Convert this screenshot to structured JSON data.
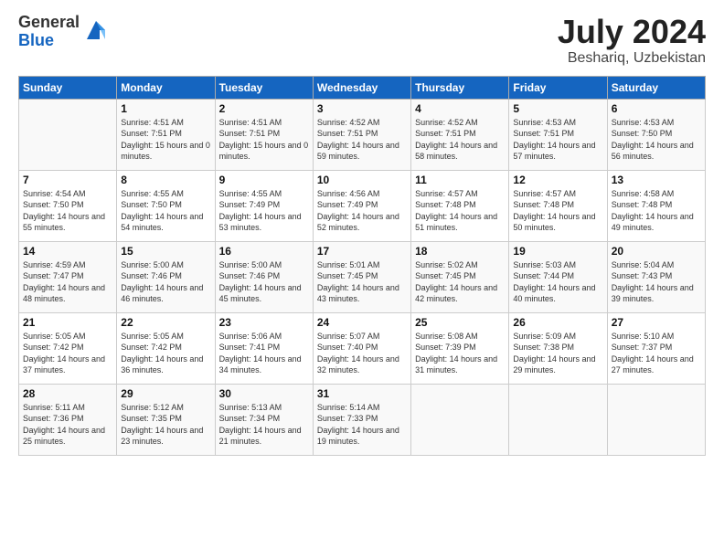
{
  "logo": {
    "general": "General",
    "blue": "Blue"
  },
  "title": {
    "month_year": "July 2024",
    "location": "Beshariq, Uzbekistan"
  },
  "days_of_week": [
    "Sunday",
    "Monday",
    "Tuesday",
    "Wednesday",
    "Thursday",
    "Friday",
    "Saturday"
  ],
  "weeks": [
    [
      {
        "day": "",
        "sunrise": "",
        "sunset": "",
        "daylight": ""
      },
      {
        "day": "1",
        "sunrise": "Sunrise: 4:51 AM",
        "sunset": "Sunset: 7:51 PM",
        "daylight": "Daylight: 15 hours and 0 minutes."
      },
      {
        "day": "2",
        "sunrise": "Sunrise: 4:51 AM",
        "sunset": "Sunset: 7:51 PM",
        "daylight": "Daylight: 15 hours and 0 minutes."
      },
      {
        "day": "3",
        "sunrise": "Sunrise: 4:52 AM",
        "sunset": "Sunset: 7:51 PM",
        "daylight": "Daylight: 14 hours and 59 minutes."
      },
      {
        "day": "4",
        "sunrise": "Sunrise: 4:52 AM",
        "sunset": "Sunset: 7:51 PM",
        "daylight": "Daylight: 14 hours and 58 minutes."
      },
      {
        "day": "5",
        "sunrise": "Sunrise: 4:53 AM",
        "sunset": "Sunset: 7:51 PM",
        "daylight": "Daylight: 14 hours and 57 minutes."
      },
      {
        "day": "6",
        "sunrise": "Sunrise: 4:53 AM",
        "sunset": "Sunset: 7:50 PM",
        "daylight": "Daylight: 14 hours and 56 minutes."
      }
    ],
    [
      {
        "day": "7",
        "sunrise": "Sunrise: 4:54 AM",
        "sunset": "Sunset: 7:50 PM",
        "daylight": "Daylight: 14 hours and 55 minutes."
      },
      {
        "day": "8",
        "sunrise": "Sunrise: 4:55 AM",
        "sunset": "Sunset: 7:50 PM",
        "daylight": "Daylight: 14 hours and 54 minutes."
      },
      {
        "day": "9",
        "sunrise": "Sunrise: 4:55 AM",
        "sunset": "Sunset: 7:49 PM",
        "daylight": "Daylight: 14 hours and 53 minutes."
      },
      {
        "day": "10",
        "sunrise": "Sunrise: 4:56 AM",
        "sunset": "Sunset: 7:49 PM",
        "daylight": "Daylight: 14 hours and 52 minutes."
      },
      {
        "day": "11",
        "sunrise": "Sunrise: 4:57 AM",
        "sunset": "Sunset: 7:48 PM",
        "daylight": "Daylight: 14 hours and 51 minutes."
      },
      {
        "day": "12",
        "sunrise": "Sunrise: 4:57 AM",
        "sunset": "Sunset: 7:48 PM",
        "daylight": "Daylight: 14 hours and 50 minutes."
      },
      {
        "day": "13",
        "sunrise": "Sunrise: 4:58 AM",
        "sunset": "Sunset: 7:48 PM",
        "daylight": "Daylight: 14 hours and 49 minutes."
      }
    ],
    [
      {
        "day": "14",
        "sunrise": "Sunrise: 4:59 AM",
        "sunset": "Sunset: 7:47 PM",
        "daylight": "Daylight: 14 hours and 48 minutes."
      },
      {
        "day": "15",
        "sunrise": "Sunrise: 5:00 AM",
        "sunset": "Sunset: 7:46 PM",
        "daylight": "Daylight: 14 hours and 46 minutes."
      },
      {
        "day": "16",
        "sunrise": "Sunrise: 5:00 AM",
        "sunset": "Sunset: 7:46 PM",
        "daylight": "Daylight: 14 hours and 45 minutes."
      },
      {
        "day": "17",
        "sunrise": "Sunrise: 5:01 AM",
        "sunset": "Sunset: 7:45 PM",
        "daylight": "Daylight: 14 hours and 43 minutes."
      },
      {
        "day": "18",
        "sunrise": "Sunrise: 5:02 AM",
        "sunset": "Sunset: 7:45 PM",
        "daylight": "Daylight: 14 hours and 42 minutes."
      },
      {
        "day": "19",
        "sunrise": "Sunrise: 5:03 AM",
        "sunset": "Sunset: 7:44 PM",
        "daylight": "Daylight: 14 hours and 40 minutes."
      },
      {
        "day": "20",
        "sunrise": "Sunrise: 5:04 AM",
        "sunset": "Sunset: 7:43 PM",
        "daylight": "Daylight: 14 hours and 39 minutes."
      }
    ],
    [
      {
        "day": "21",
        "sunrise": "Sunrise: 5:05 AM",
        "sunset": "Sunset: 7:42 PM",
        "daylight": "Daylight: 14 hours and 37 minutes."
      },
      {
        "day": "22",
        "sunrise": "Sunrise: 5:05 AM",
        "sunset": "Sunset: 7:42 PM",
        "daylight": "Daylight: 14 hours and 36 minutes."
      },
      {
        "day": "23",
        "sunrise": "Sunrise: 5:06 AM",
        "sunset": "Sunset: 7:41 PM",
        "daylight": "Daylight: 14 hours and 34 minutes."
      },
      {
        "day": "24",
        "sunrise": "Sunrise: 5:07 AM",
        "sunset": "Sunset: 7:40 PM",
        "daylight": "Daylight: 14 hours and 32 minutes."
      },
      {
        "day": "25",
        "sunrise": "Sunrise: 5:08 AM",
        "sunset": "Sunset: 7:39 PM",
        "daylight": "Daylight: 14 hours and 31 minutes."
      },
      {
        "day": "26",
        "sunrise": "Sunrise: 5:09 AM",
        "sunset": "Sunset: 7:38 PM",
        "daylight": "Daylight: 14 hours and 29 minutes."
      },
      {
        "day": "27",
        "sunrise": "Sunrise: 5:10 AM",
        "sunset": "Sunset: 7:37 PM",
        "daylight": "Daylight: 14 hours and 27 minutes."
      }
    ],
    [
      {
        "day": "28",
        "sunrise": "Sunrise: 5:11 AM",
        "sunset": "Sunset: 7:36 PM",
        "daylight": "Daylight: 14 hours and 25 minutes."
      },
      {
        "day": "29",
        "sunrise": "Sunrise: 5:12 AM",
        "sunset": "Sunset: 7:35 PM",
        "daylight": "Daylight: 14 hours and 23 minutes."
      },
      {
        "day": "30",
        "sunrise": "Sunrise: 5:13 AM",
        "sunset": "Sunset: 7:34 PM",
        "daylight": "Daylight: 14 hours and 21 minutes."
      },
      {
        "day": "31",
        "sunrise": "Sunrise: 5:14 AM",
        "sunset": "Sunset: 7:33 PM",
        "daylight": "Daylight: 14 hours and 19 minutes."
      },
      {
        "day": "",
        "sunrise": "",
        "sunset": "",
        "daylight": ""
      },
      {
        "day": "",
        "sunrise": "",
        "sunset": "",
        "daylight": ""
      },
      {
        "day": "",
        "sunrise": "",
        "sunset": "",
        "daylight": ""
      }
    ]
  ]
}
